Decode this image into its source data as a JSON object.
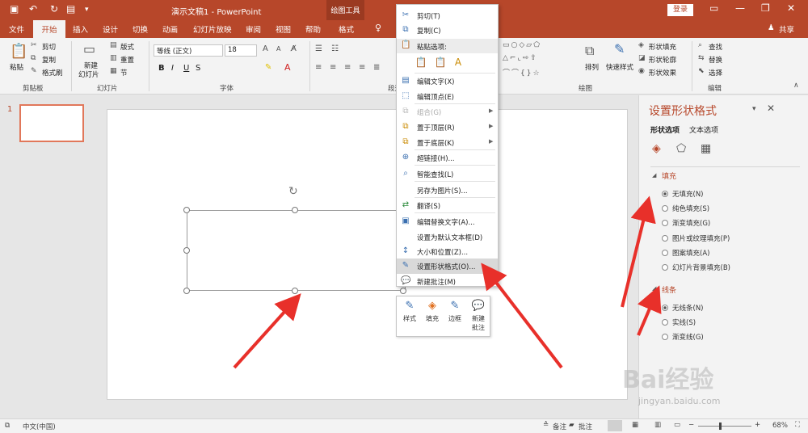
{
  "titlebar": {
    "title": "演示文稿1  -  PowerPoint",
    "tool_context": "绘图工具",
    "login": "登录",
    "qa_icons": [
      "save-icon",
      "undo-icon",
      "redo-icon",
      "present-from-start-icon",
      "customize-qa-icon"
    ]
  },
  "menu": {
    "tabs": [
      "文件",
      "开始",
      "插入",
      "设计",
      "切换",
      "动画",
      "幻灯片放映",
      "审阅",
      "视图",
      "帮助",
      "格式"
    ],
    "active": "开始",
    "share": "共享"
  },
  "ribbon": {
    "clipboard": {
      "paste": "粘贴",
      "cut": "剪切",
      "copy": "复制",
      "format_painter": "格式刷",
      "label": "剪贴板"
    },
    "slides": {
      "new_slide": "新建",
      "new_slide2": "幻灯片",
      "layout": "版式",
      "reset": "重置",
      "section": "节",
      "label": "幻灯片"
    },
    "font": {
      "font_name": "等线 (正文)",
      "font_size": "18",
      "bold": "B",
      "italic": "I",
      "underline": "U",
      "strike": "S",
      "label": "字体"
    },
    "paragraph": {
      "label": "段落"
    },
    "drawing": {
      "arrange": "排列",
      "quick_styles": "快速样式",
      "shape_fill": "形状填充",
      "shape_outline": "形状轮廓",
      "shape_effects": "形状效果",
      "label": "绘图"
    },
    "editing": {
      "find": "查找",
      "replace": "替换",
      "select": "选择",
      "label": "编辑"
    }
  },
  "slides_pane": {
    "slide_number": "1"
  },
  "context_menu": {
    "paste_options_label": "粘贴选项:",
    "items": [
      {
        "label": "剪切(T)",
        "icon": "scissors-icon",
        "disabled": false,
        "submenu": false
      },
      {
        "label": "复制(C)",
        "icon": "copy-icon",
        "disabled": false,
        "submenu": false
      },
      {
        "label": "编辑文字(X)",
        "icon": "edit-text-icon",
        "disabled": false,
        "submenu": false
      },
      {
        "label": "编辑顶点(E)",
        "icon": "edit-points-icon",
        "disabled": false,
        "submenu": false
      },
      {
        "label": "组合(G)",
        "icon": "group-icon",
        "disabled": true,
        "submenu": true
      },
      {
        "label": "置于顶层(R)",
        "icon": "bring-front-icon",
        "disabled": false,
        "submenu": true
      },
      {
        "label": "置于底层(K)",
        "icon": "send-back-icon",
        "disabled": false,
        "submenu": true
      },
      {
        "label": "超链接(H)...",
        "icon": "hyperlink-icon",
        "disabled": false,
        "submenu": false
      },
      {
        "label": "智能查找(L)",
        "icon": "smart-lookup-icon",
        "disabled": false,
        "submenu": false
      },
      {
        "label": "另存为图片(S)...",
        "icon": "",
        "disabled": false,
        "submenu": false
      },
      {
        "label": "翻译(S)",
        "icon": "translate-icon",
        "disabled": false,
        "submenu": false
      },
      {
        "label": "编辑替换文字(A)...",
        "icon": "alt-text-icon",
        "disabled": false,
        "submenu": false
      },
      {
        "label": "设置为默认文本框(D)",
        "icon": "",
        "disabled": false,
        "submenu": false
      },
      {
        "label": "大小和位置(Z)...",
        "icon": "size-position-icon",
        "disabled": false,
        "submenu": false
      },
      {
        "label": "设置形状格式(O)...",
        "icon": "format-shape-icon",
        "disabled": false,
        "submenu": false,
        "highlighted": true
      },
      {
        "label": "新建批注(M)",
        "icon": "new-comment-icon",
        "disabled": false,
        "submenu": false
      }
    ]
  },
  "mini_toolbar": {
    "buttons": [
      {
        "label": "样式",
        "icon": "style-icon"
      },
      {
        "label": "填充",
        "icon": "fill-icon"
      },
      {
        "label": "边框",
        "icon": "border-icon"
      },
      {
        "label": "新建\n批注",
        "label1": "新建",
        "label2": "批注",
        "icon": "comment-icon"
      }
    ]
  },
  "format_pane": {
    "title": "设置形状格式",
    "tabs": [
      "形状选项",
      "文本选项"
    ],
    "icons": [
      "fill-line-icon",
      "effects-icon",
      "size-properties-icon"
    ],
    "fill_section": "填充",
    "fill_options": [
      "无填充(N)",
      "纯色填充(S)",
      "渐变填充(G)",
      "图片或纹理填充(P)",
      "图案填充(A)",
      "幻灯片背景填充(B)"
    ],
    "fill_selected": 0,
    "line_section": "线条",
    "line_options": [
      "无线条(N)",
      "实线(S)",
      "渐变线(G)"
    ],
    "line_selected": 0
  },
  "statusbar": {
    "language": "中文(中国)",
    "notes": "备注",
    "comments": "批注",
    "zoom": "68%"
  },
  "watermark": {
    "brand": "Bai经验",
    "url": "jingyan.baidu.com"
  },
  "colors": {
    "accent": "#b7472a",
    "arrow": "#e8302a"
  }
}
